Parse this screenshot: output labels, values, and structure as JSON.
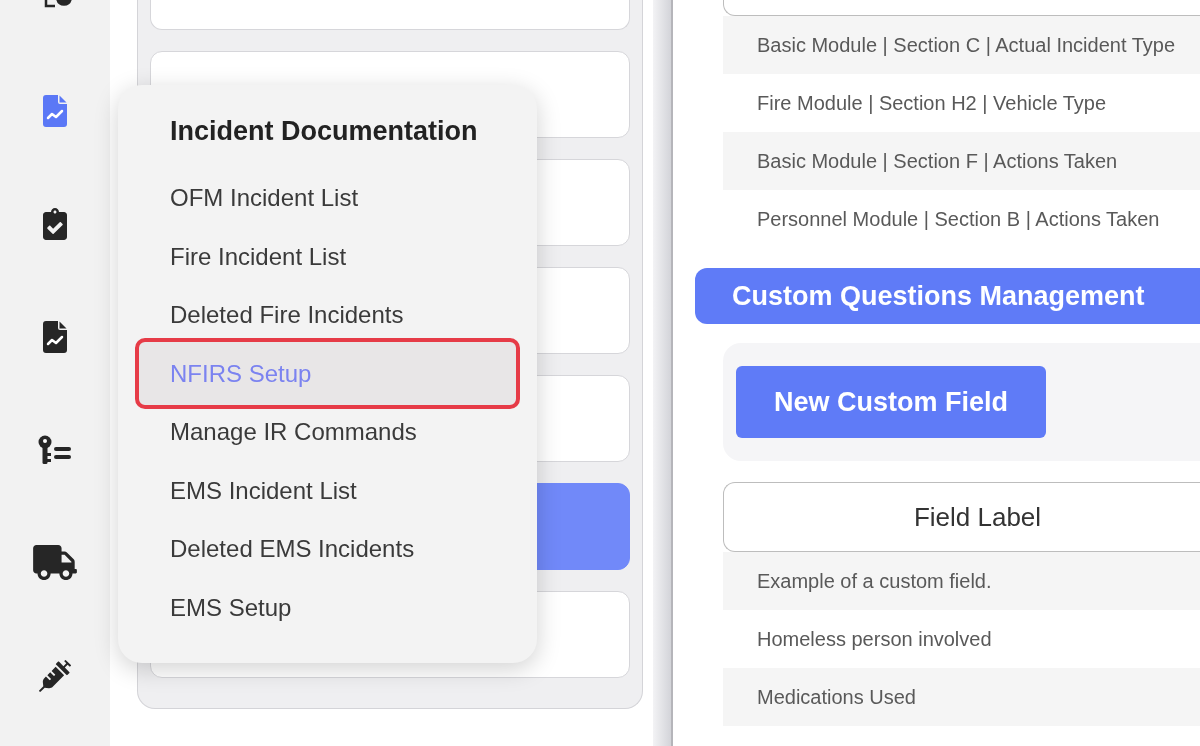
{
  "sidebar": {
    "items": [
      {
        "selected": false
      },
      {
        "selected": true
      },
      {
        "selected": false
      },
      {
        "selected": false
      },
      {
        "selected": false
      },
      {
        "selected": false
      },
      {
        "selected": false
      }
    ]
  },
  "card_list": {
    "cards": [
      {
        "selected": false
      },
      {
        "selected": false
      },
      {
        "selected": false
      },
      {
        "selected": false
      },
      {
        "selected": false
      },
      {
        "selected": true
      },
      {
        "selected": false
      }
    ]
  },
  "menu": {
    "title": "Incident Documentation",
    "items": [
      {
        "label": "OFM Incident List",
        "selected": false
      },
      {
        "label": "Fire Incident List",
        "selected": false
      },
      {
        "label": "Deleted Fire Incidents",
        "selected": false
      },
      {
        "label": "NFIRS Setup",
        "selected": true
      },
      {
        "label": "Manage IR Commands",
        "selected": false
      },
      {
        "label": "EMS Incident List",
        "selected": false
      },
      {
        "label": "Deleted EMS Incidents",
        "selected": false
      },
      {
        "label": "EMS Setup",
        "selected": false
      }
    ]
  },
  "nfirs_table": {
    "rows": [
      "Basic Module | Section C | Actual Incident Type",
      "Fire Module | Section H2 | Vehicle Type",
      "Basic Module | Section F | Actions Taken",
      "Personnel Module | Section B | Actions Taken"
    ]
  },
  "custom_questions": {
    "title": "Custom Questions Management",
    "new_field_button": "New Custom Field",
    "table": {
      "columns": [
        "Field Label"
      ],
      "rows": [
        "Example of a custom field.",
        "Homeless person involved",
        "Medications Used"
      ]
    }
  }
}
